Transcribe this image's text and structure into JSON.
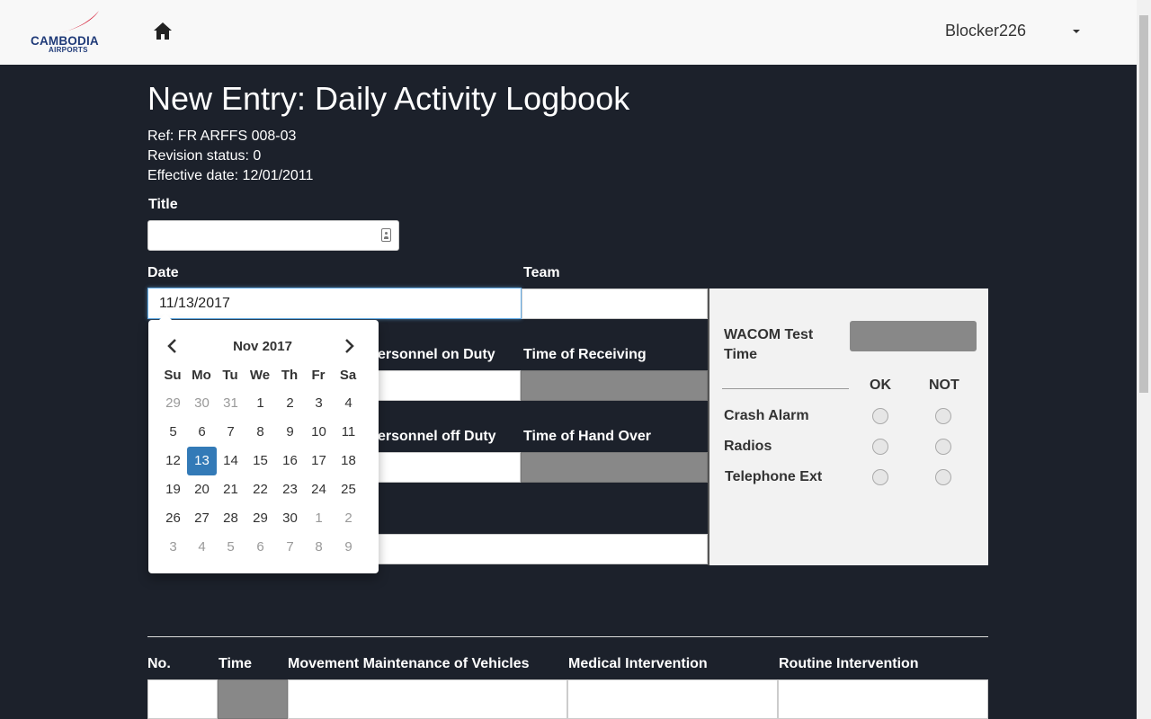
{
  "header": {
    "logo_line1": "CAMBODIA",
    "logo_line2": "AIRPORTS",
    "username": "Blocker226",
    "brand_red": "#d6213a",
    "brand_blue": "#1f3a78"
  },
  "page": {
    "title": "New Entry: Daily Activity Logbook",
    "ref": "Ref: FR ARFFS 008-03",
    "revision": "Revision status: 0",
    "effective": "Effective date: 12/01/2011"
  },
  "form": {
    "title_label": "Title",
    "title_value": "",
    "date_label": "Date",
    "date_value": "11/13/2017",
    "team_label": "Team",
    "personnel_on_label": "ersonnel on Duty",
    "time_receiving_label": "Time of Receiving",
    "personnel_off_label": "ersonnel off Duty",
    "time_handover_label": "Time of Hand Over"
  },
  "checks": {
    "wacom_label_1": "WACOM Test",
    "wacom_label_2": "Time",
    "ok_label": "OK",
    "not_label": "NOT",
    "items": [
      "Crash Alarm",
      "Radios",
      "Telephone Ext"
    ]
  },
  "datepicker": {
    "month": "Nov 2017",
    "weekdays": [
      "Su",
      "Mo",
      "Tu",
      "We",
      "Th",
      "Fr",
      "Sa"
    ],
    "weeks": [
      [
        "29",
        "30",
        "31",
        "1",
        "2",
        "3",
        "4"
      ],
      [
        "5",
        "6",
        "7",
        "8",
        "9",
        "10",
        "11"
      ],
      [
        "12",
        "13",
        "14",
        "15",
        "16",
        "17",
        "18"
      ],
      [
        "19",
        "20",
        "21",
        "22",
        "23",
        "24",
        "25"
      ],
      [
        "26",
        "27",
        "28",
        "29",
        "30",
        "1",
        "2"
      ],
      [
        "3",
        "4",
        "5",
        "6",
        "7",
        "8",
        "9"
      ]
    ],
    "selected": "13",
    "accent": "#337ab7"
  },
  "table": {
    "headers": [
      "No.",
      "Time",
      "Movement Maintenance of Vehicles",
      "Medical Intervention",
      "Routine Intervention"
    ]
  }
}
